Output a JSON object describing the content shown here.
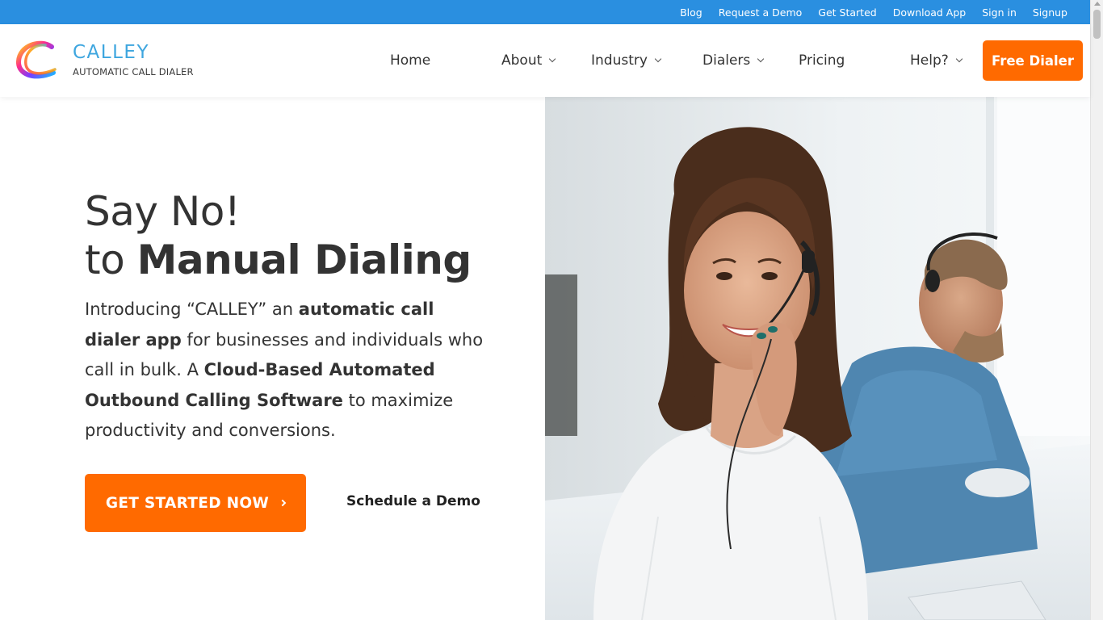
{
  "topbar": {
    "links": [
      "Blog",
      "Request a Demo",
      "Get Started",
      "Download App",
      "Sign in",
      "Signup"
    ],
    "bg_color": "#2a8fe0"
  },
  "logo": {
    "name": "CALLEY",
    "tagline": "AUTOMATIC CALL DIALER"
  },
  "nav": {
    "home": "Home",
    "about": "About",
    "industry": "Industry",
    "dialers": "Dialers",
    "pricing": "Pricing",
    "help": "Help?",
    "free_dialer": "Free Dialer"
  },
  "hero": {
    "line1": "Say No!",
    "line2_prefix": "to",
    "line2_bold": "Manual Dialing",
    "desc": {
      "p1": "Introducing “CALLEY” an ",
      "b1": "automatic call dialer app",
      "p2": " for businesses and individuals who call in bulk. A ",
      "b2": "Cloud-Based Automated Outbound Calling Software",
      "p3": " to maximize productivity and conversions."
    },
    "cta": "GET STARTED NOW",
    "demo": "Schedule a Demo",
    "image_desc": "call-center-agents-photo"
  },
  "colors": {
    "accent": "#ff6a00",
    "brand_blue": "#3ea6df"
  }
}
